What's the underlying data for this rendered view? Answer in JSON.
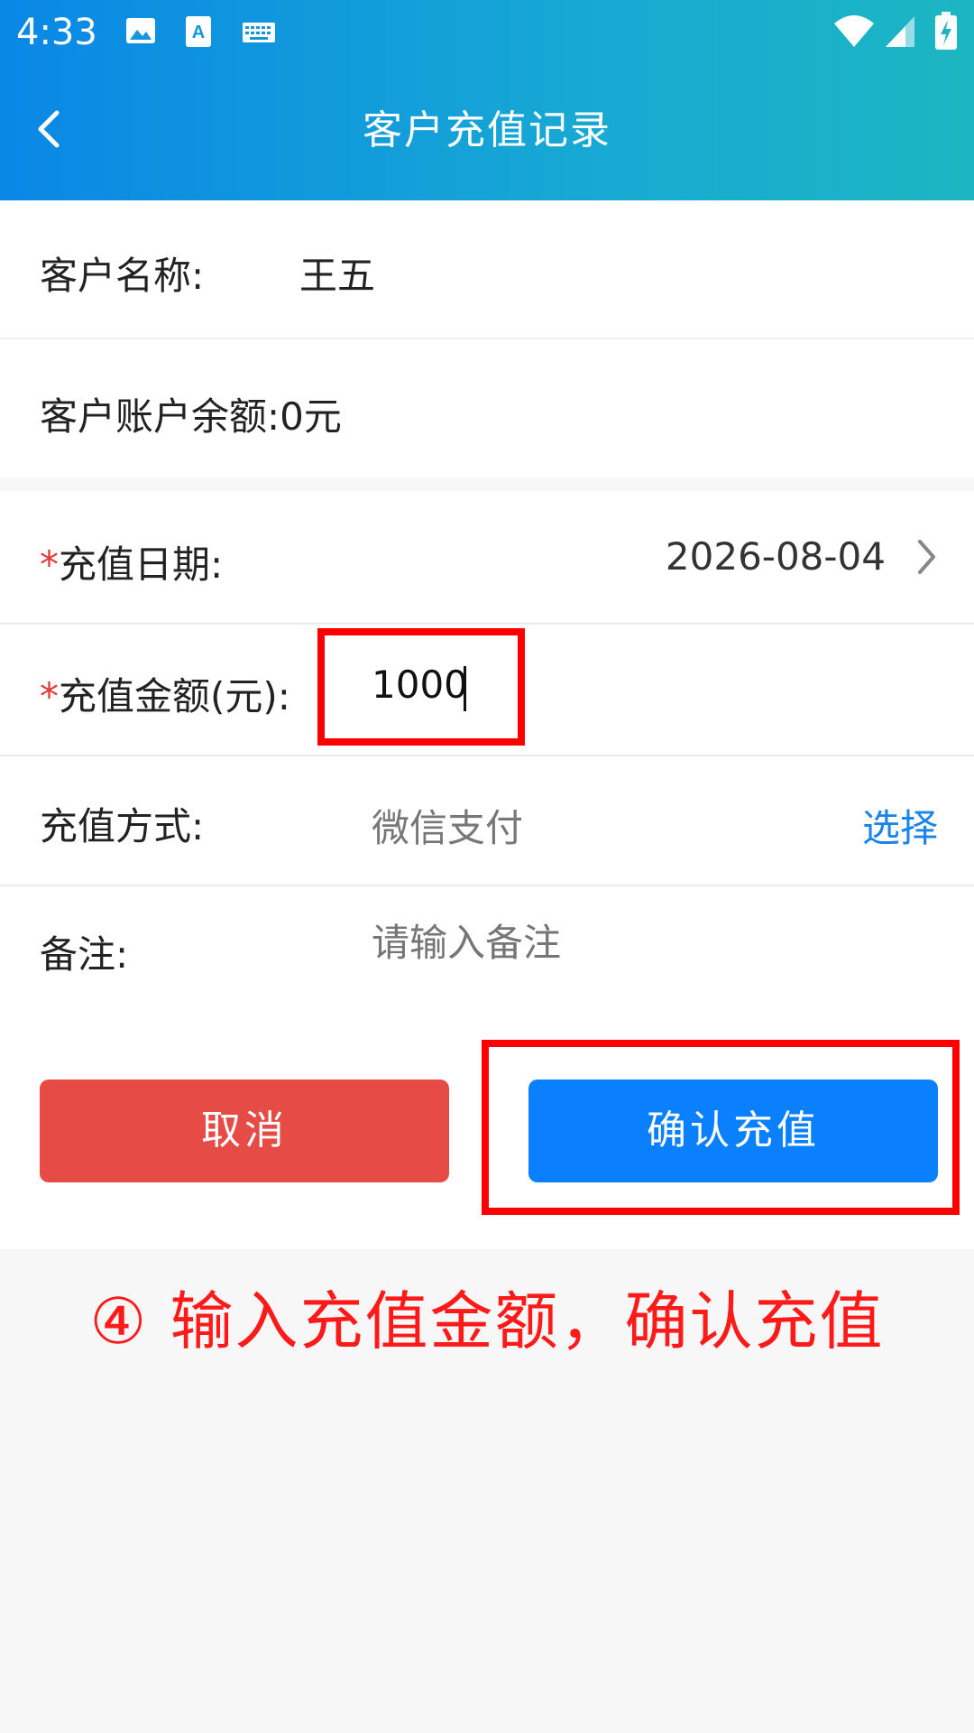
{
  "status": {
    "time": "4:33"
  },
  "header": {
    "title": "客户充值记录"
  },
  "customer": {
    "name_label": "客户名称:",
    "name_value": "王五",
    "balance_label": "客户账户余额:0元"
  },
  "form": {
    "required_mark": "*",
    "date_label": "充值日期:",
    "date_value": "2026-08-04",
    "amount_label": "充值金额(元):",
    "amount_value": "1000",
    "method_label": "充值方式:",
    "method_value": "微信支付",
    "method_select": "选择",
    "note_label": "备注:",
    "note_placeholder": "请输入备注"
  },
  "buttons": {
    "cancel": "取消",
    "confirm": "确认充值"
  },
  "annotation": {
    "text": "④ 输入充值金额，确认充值"
  },
  "colors": {
    "header_gradient_start": "#0a87e6",
    "header_gradient_end": "#1cb6c2",
    "cancel_button": "#e64c45",
    "confirm_button": "#0a80ff",
    "highlight": "#ff0000",
    "link": "#1a84e8"
  },
  "icons": {
    "back": "chevron-left-icon",
    "image": "image-icon",
    "font": "font-a-icon",
    "keyboard": "keyboard-icon",
    "wifi": "wifi-icon",
    "signal": "signal-icon",
    "battery": "battery-charging-icon",
    "date_arrow": "chevron-right-icon"
  }
}
